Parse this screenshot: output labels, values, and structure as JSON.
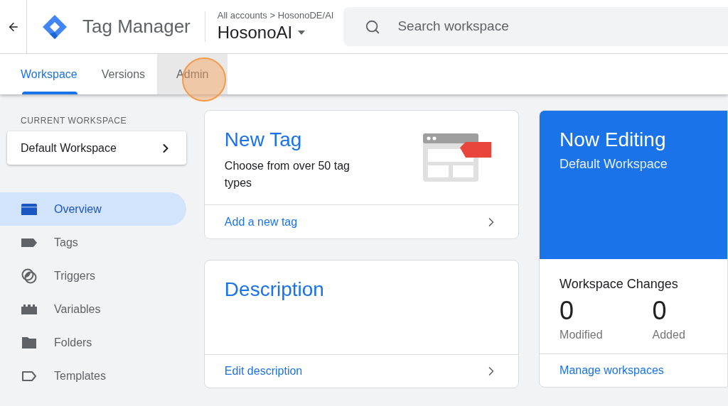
{
  "header": {
    "product": "Tag Manager",
    "breadcrumb": "All accounts > HosonoDE/AI",
    "container": "HosonoAI",
    "search": {
      "placeholder": "Search workspace"
    }
  },
  "tabs": [
    {
      "label": "Workspace",
      "selected": true,
      "hovered": false
    },
    {
      "label": "Versions",
      "selected": false,
      "hovered": false
    },
    {
      "label": "Admin",
      "selected": false,
      "hovered": true
    }
  ],
  "sidebar": {
    "heading": "CURRENT WORKSPACE",
    "workspace": "Default Workspace",
    "items": [
      {
        "label": "Overview",
        "kind": "overview",
        "selected": true
      },
      {
        "label": "Tags",
        "kind": "tags",
        "selected": false
      },
      {
        "label": "Triggers",
        "kind": "triggers",
        "selected": false
      },
      {
        "label": "Variables",
        "kind": "variables",
        "selected": false
      },
      {
        "label": "Folders",
        "kind": "folders",
        "selected": false
      },
      {
        "label": "Templates",
        "kind": "templates",
        "selected": false
      }
    ]
  },
  "new_tag_card": {
    "title": "New Tag",
    "text": "Choose from over 50 tag types",
    "link": "Add a new tag"
  },
  "description_card": {
    "title": "Description",
    "link": "Edit description"
  },
  "now_editing_card": {
    "title": "Now Editing",
    "workspace": "Default Workspace",
    "changes_title": "Workspace Changes",
    "stats": [
      {
        "value": "0",
        "label": "Modified"
      },
      {
        "value": "0",
        "label": "Added"
      }
    ],
    "link": "Manage workspaces"
  }
}
